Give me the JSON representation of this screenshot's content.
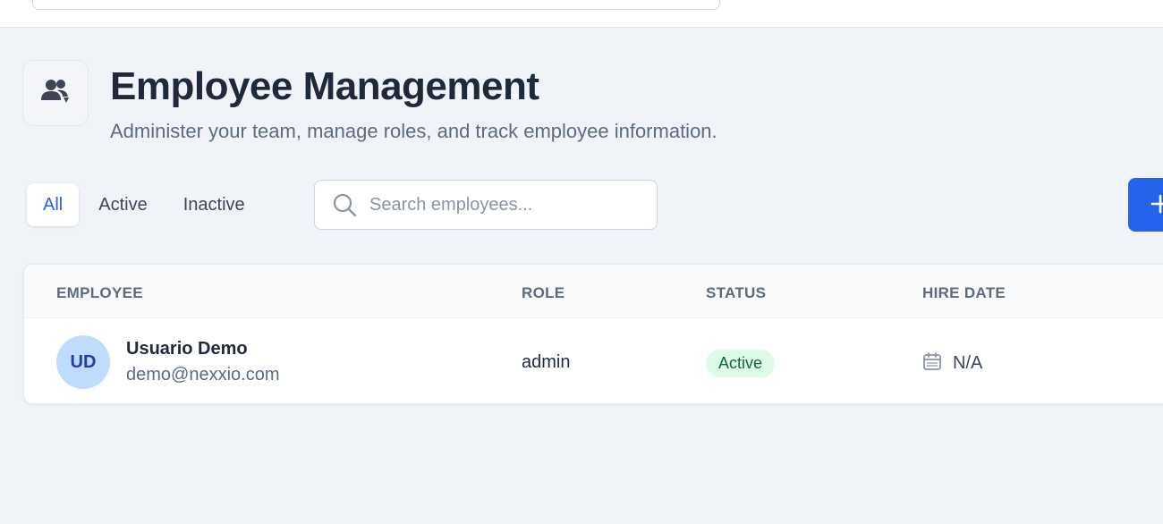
{
  "header": {
    "title": "Employee Management",
    "subtitle": "Administer your team, manage roles, and track employee information."
  },
  "tabs": [
    {
      "label": "All",
      "active": true
    },
    {
      "label": "Active",
      "active": false
    },
    {
      "label": "Inactive",
      "active": false
    }
  ],
  "search": {
    "placeholder": "Search employees...",
    "value": ""
  },
  "table": {
    "columns": [
      "EMPLOYEE",
      "ROLE",
      "STATUS",
      "HIRE DATE"
    ],
    "rows": [
      {
        "initials": "UD",
        "name": "Usuario Demo",
        "email": "demo@nexxio.com",
        "role": "admin",
        "status": "Active",
        "hire_date": "N/A"
      }
    ]
  },
  "icons": {
    "header": "users-icon",
    "search": "search-icon",
    "add": "plus-icon",
    "hire_date": "calendar-icon"
  },
  "colors": {
    "accent": "#2563eb",
    "status_active_bg": "#dcfce7",
    "status_active_text": "#166534",
    "avatar_bg": "#bfdbfe"
  }
}
